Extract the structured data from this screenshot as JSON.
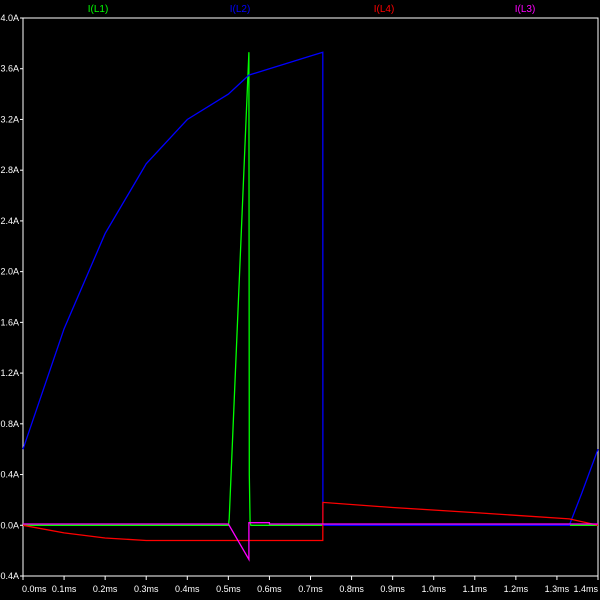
{
  "chart_data": {
    "type": "line",
    "title": "",
    "xlabel": "",
    "ylabel": "",
    "xlim": [
      0,
      1.4
    ],
    "ylim": [
      -0.4,
      4.0
    ],
    "x_ticks": [
      0,
      0.1,
      0.2,
      0.3,
      0.4,
      0.5,
      0.6,
      0.7,
      0.8,
      0.9,
      1.0,
      1.1,
      1.2,
      1.3,
      1.4
    ],
    "x_tick_labels": [
      "0.0ms",
      "0.1ms",
      "0.2ms",
      "0.3ms",
      "0.4ms",
      "0.5ms",
      "0.6ms",
      "0.7ms",
      "0.8ms",
      "0.9ms",
      "1.0ms",
      "1.1ms",
      "1.2ms",
      "1.3ms",
      "1.4ms"
    ],
    "y_ticks": [
      4.0,
      3.6,
      3.2,
      2.8,
      2.4,
      2.0,
      1.6,
      1.2,
      0.8,
      0.4,
      0.0,
      -0.4
    ],
    "y_tick_labels": [
      "4.0A",
      "3.6A",
      "3.2A",
      "2.8A",
      "2.4A",
      "2.0A",
      "1.6A",
      "1.2A",
      "0.8A",
      "0.4A",
      "0.0A",
      "-0.4A"
    ],
    "grid": false,
    "legend_position": "top",
    "series": [
      {
        "name": "I(L1)",
        "color": "#00ff00",
        "x": [
          0,
          0.5,
          0.502,
          0.55,
          0.551,
          0.553,
          0.555,
          0.73,
          1.32,
          1.4
        ],
        "y": [
          0,
          0,
          0.05,
          3.73,
          0.4,
          0.02,
          0,
          0,
          0,
          0
        ]
      },
      {
        "name": "I(L2)",
        "color": "#0000ff",
        "x": [
          0,
          0.1,
          0.2,
          0.3,
          0.4,
          0.5,
          0.55,
          0.6,
          0.65,
          0.7,
          0.73,
          0.7301,
          1.33,
          1.36,
          1.4
        ],
        "y": [
          0.6,
          1.55,
          2.3,
          2.85,
          3.2,
          3.4,
          3.55,
          3.6,
          3.65,
          3.7,
          3.73,
          0,
          0,
          0.25,
          0.6
        ]
      },
      {
        "name": "I(L4)",
        "color": "#ff0000",
        "x": [
          0,
          0.1,
          0.2,
          0.3,
          0.4,
          0.73,
          0.7301,
          0.9,
          1.1,
          1.33,
          1.4
        ],
        "y": [
          0,
          -0.06,
          -0.1,
          -0.12,
          -0.12,
          -0.12,
          0.18,
          0.14,
          0.1,
          0.05,
          0
        ]
      },
      {
        "name": "I(L3)",
        "color": "#ff00ff",
        "x": [
          0,
          0.5,
          0.55,
          0.5501,
          0.6,
          0.6001,
          0.73,
          1.4
        ],
        "y": [
          0.01,
          0.01,
          -0.27,
          0.02,
          0.02,
          0.01,
          0.01,
          0.01
        ]
      }
    ]
  }
}
